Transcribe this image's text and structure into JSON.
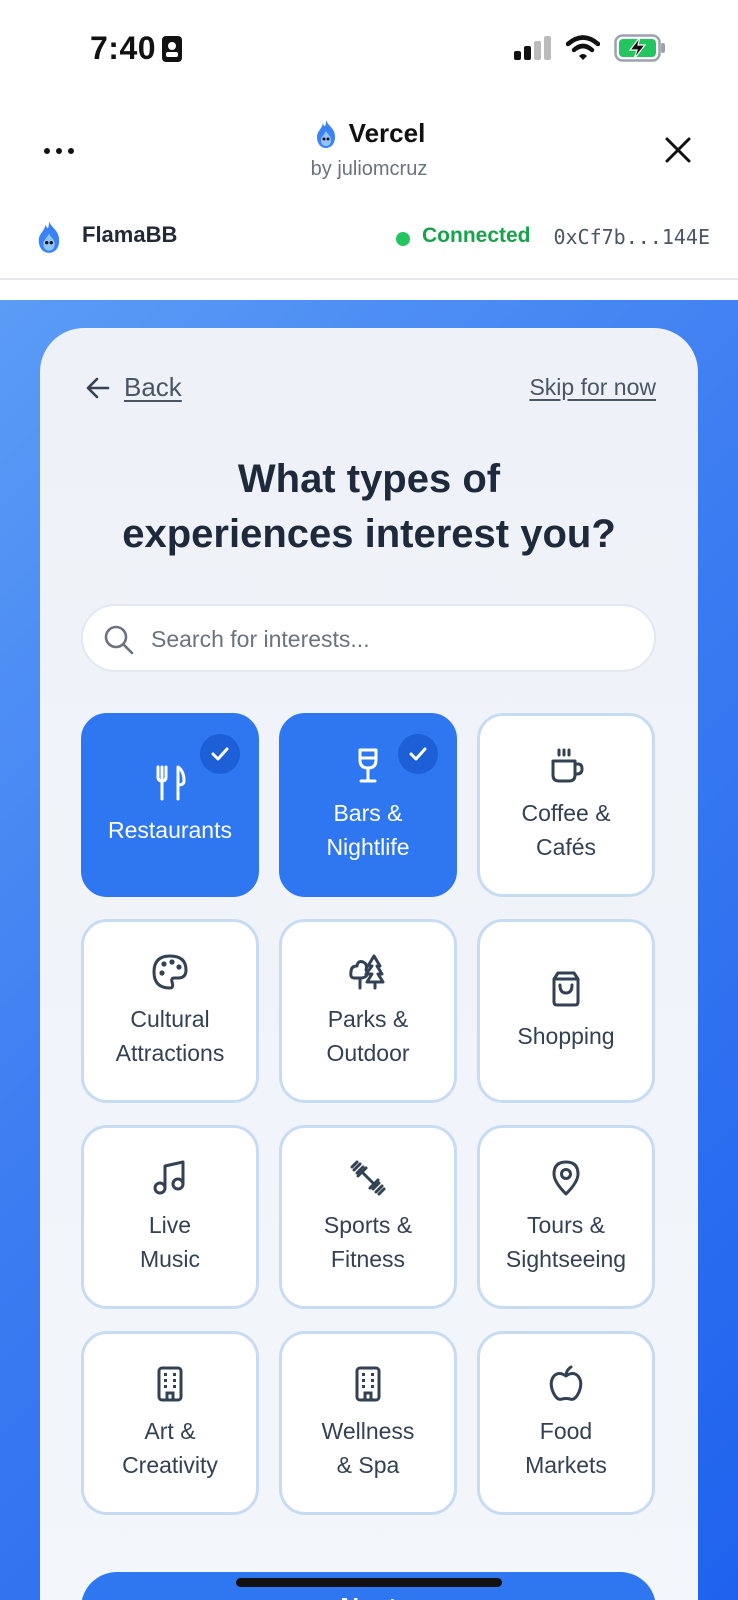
{
  "status_bar": {
    "time": "7:40",
    "battery_color": "#22c55e"
  },
  "app_header": {
    "title": "Vercel",
    "subtitle": "by juliomcruz",
    "more_icon": "more-icon",
    "close_icon": "close-icon"
  },
  "wallet": {
    "name": "FlamaBB",
    "status": "Connected",
    "address": "0xCf7b...144E",
    "status_color": "#16a34a"
  },
  "onboarding": {
    "back_label": "Back",
    "skip_label": "Skip for now",
    "heading_line1": "What types of",
    "heading_line2": "experiences interest you?",
    "search_placeholder": "Search for interests...",
    "next_label": "Next",
    "accent_color": "#2f77f0"
  },
  "interests": [
    {
      "label": "Restaurants",
      "icon": "utensils-icon",
      "selected": true
    },
    {
      "label": "Bars &\nNightlife",
      "icon": "wine-glass-icon",
      "selected": true
    },
    {
      "label": "Coffee &\nCafés",
      "icon": "coffee-cup-icon",
      "selected": false
    },
    {
      "label": "Cultural\nAttractions",
      "icon": "palette-icon",
      "selected": false
    },
    {
      "label": "Parks &\nOutdoor",
      "icon": "trees-icon",
      "selected": false
    },
    {
      "label": "Shopping",
      "icon": "shopping-bag-icon",
      "selected": false
    },
    {
      "label": "Live\nMusic",
      "icon": "music-note-icon",
      "selected": false
    },
    {
      "label": "Sports &\nFitness",
      "icon": "dumbbell-icon",
      "selected": false
    },
    {
      "label": "Tours &\nSightseeing",
      "icon": "map-pin-icon",
      "selected": false
    },
    {
      "label": "Art &\nCreativity",
      "icon": "building-icon",
      "selected": false
    },
    {
      "label": "Wellness\n& Spa",
      "icon": "building-icon",
      "selected": false
    },
    {
      "label": "Food\nMarkets",
      "icon": "apple-icon",
      "selected": false
    }
  ]
}
